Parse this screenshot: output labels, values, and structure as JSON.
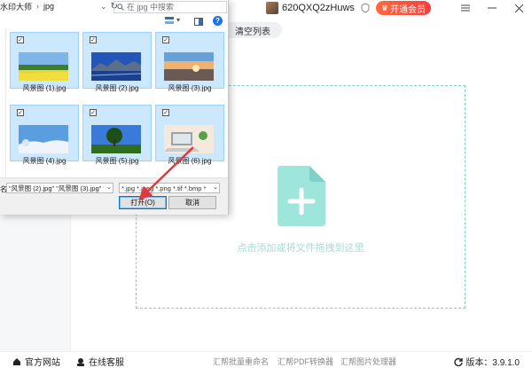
{
  "header": {
    "username": "620QXQ2zHuws",
    "vip_label": "开通会员",
    "menu_icon": "menu-icon",
    "minimize_icon": "minimize-icon",
    "close_icon": "close-icon"
  },
  "toolbar": {
    "clear_label": "清空列表"
  },
  "dropzone": {
    "hint": "点击添加或将文件拖拽到这里",
    "accent": "#7ed1c8",
    "icon": "file-add-icon"
  },
  "footer": {
    "website": "官方网站",
    "support": "在线客服",
    "links": [
      "汇帮批量重命名",
      "汇帮PDF转换器",
      "汇帮图片处理器"
    ],
    "version": "版本：3.9.1.0"
  },
  "dialog": {
    "breadcrumb": [
      "水印大师",
      "jpg"
    ],
    "search_placeholder": "在 jpg 中搜索",
    "files": [
      {
        "name": "风景图 (1).jpg",
        "selected": true,
        "icon": "landscape-thumbnail"
      },
      {
        "name": "风景图 (2).jpg",
        "selected": true,
        "icon": "landscape-thumbnail"
      },
      {
        "name": "风景图 (3).jpg",
        "selected": true,
        "icon": "landscape-thumbnail"
      },
      {
        "name": "风景图 (4).jpg",
        "selected": true,
        "icon": "landscape-thumbnail"
      },
      {
        "name": "风景图 (5).jpg",
        "selected": true,
        "icon": "landscape-thumbnail"
      },
      {
        "name": "风景图 (6).jpg",
        "selected": true,
        "icon": "landscape-thumbnail"
      }
    ],
    "filename_label": "名:",
    "filename_value": "\"风景图 (2).jpg\" \"风景图 (3).jpg\" \"",
    "filter_value": "*.jpg *.jpeg *.png *.tif *.bmp *",
    "open_label": "打开(O)",
    "cancel_label": "取消",
    "help_label": "?",
    "selection_color": "#cce8ff"
  },
  "annotation_color": "#e0393e"
}
